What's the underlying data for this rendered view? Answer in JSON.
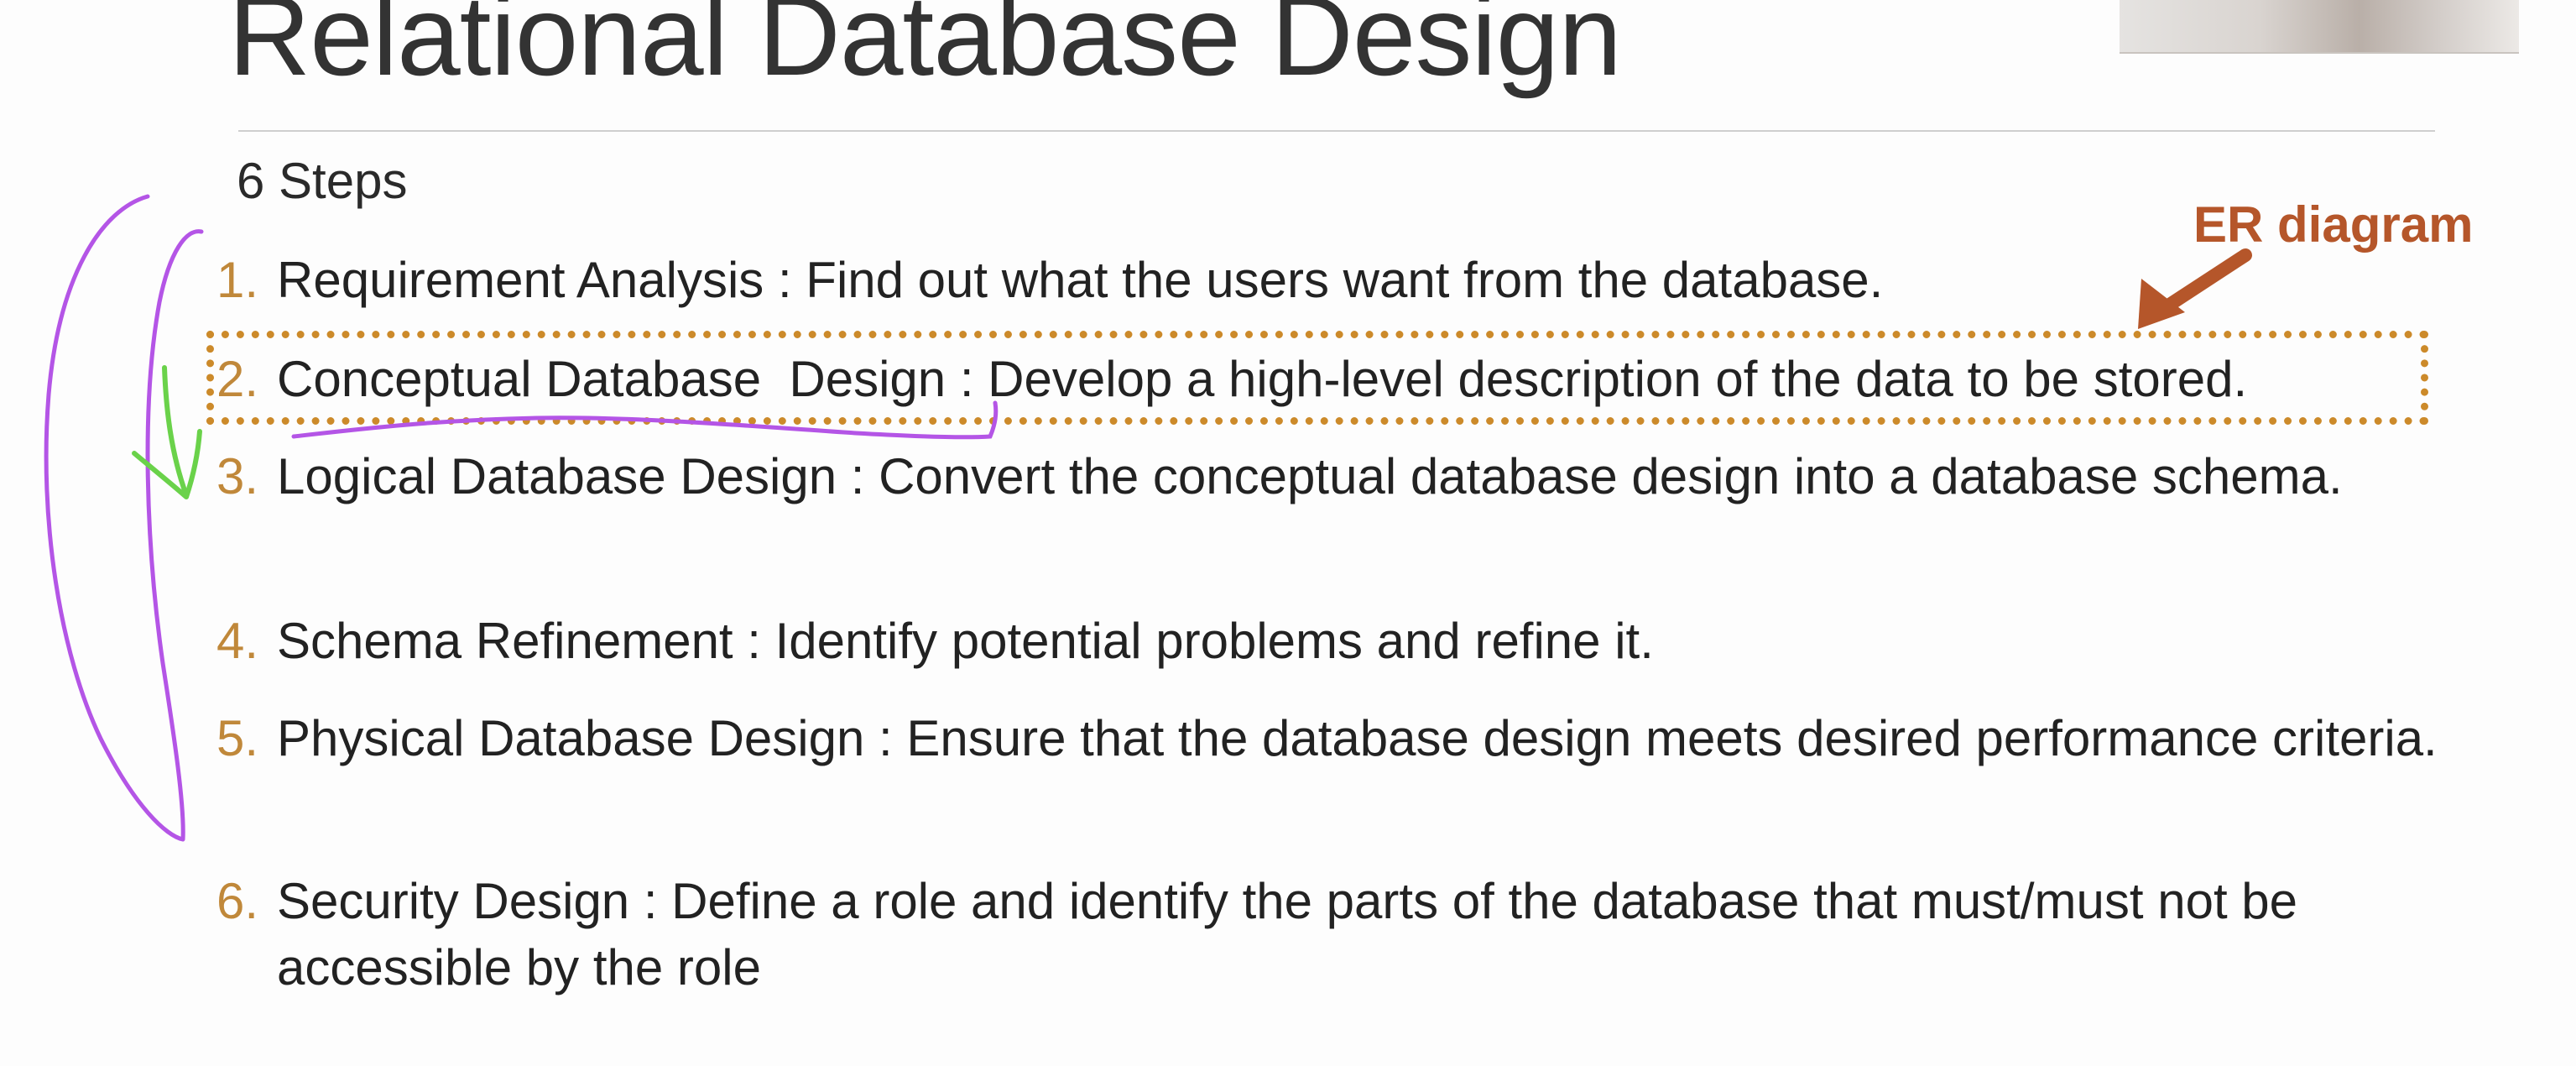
{
  "slide": {
    "title": "Relational Database Design",
    "subheading": "6 Steps",
    "steps": [
      {
        "number": "1.",
        "text": "Requirement Analysis : Find out what the users want from the database."
      },
      {
        "number": "2.",
        "text": "Conceptual Database  Design : Develop a high-level description of the data to be stored."
      },
      {
        "number": "3.",
        "text": "Logical Database Design : Convert the conceptual database design into a database schema."
      },
      {
        "number": "4.",
        "text": "Schema Refinement : Identify potential problems and refine it."
      },
      {
        "number": "5.",
        "text": "Physical Database Design : Ensure that the database design meets desired performance criteria."
      },
      {
        "number": "6.",
        "text": "Security Design : Define a role and identify the parts of the database that must/must not be accessible by the role"
      }
    ]
  },
  "annotations": {
    "callout_label": "ER diagram",
    "colors": {
      "step_number": "#c0883a",
      "highlight_box": "#cc8a2a",
      "callout": "#b5562a",
      "pen_purple": "#b455e6",
      "pen_green": "#6ad24a"
    }
  }
}
